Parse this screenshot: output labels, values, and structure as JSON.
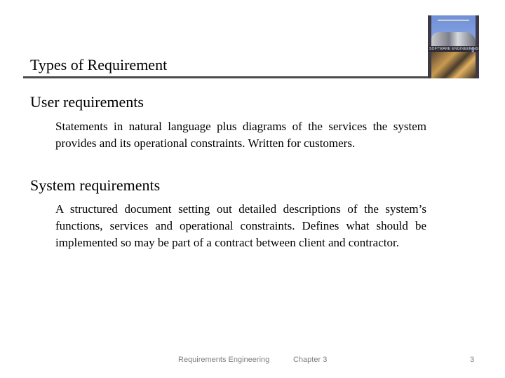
{
  "slide": {
    "title": "Types of Requirement",
    "cover_image": {
      "label": "SOFTWARE ENGINEERING",
      "edition": "9"
    },
    "sections": [
      {
        "heading": "User requirements",
        "body": "Statements in natural language plus diagrams of the services the system provides and its operational constraints. Written for customers."
      },
      {
        "heading": "System requirements",
        "body": "A structured document setting out detailed descriptions of the system’s functions, services and operational constraints. Defines what should be implemented so may be part of a contract between client and contractor."
      }
    ]
  },
  "footer": {
    "course": "Requirements Engineering",
    "chapter": "Chapter 3",
    "page_number": "3"
  }
}
